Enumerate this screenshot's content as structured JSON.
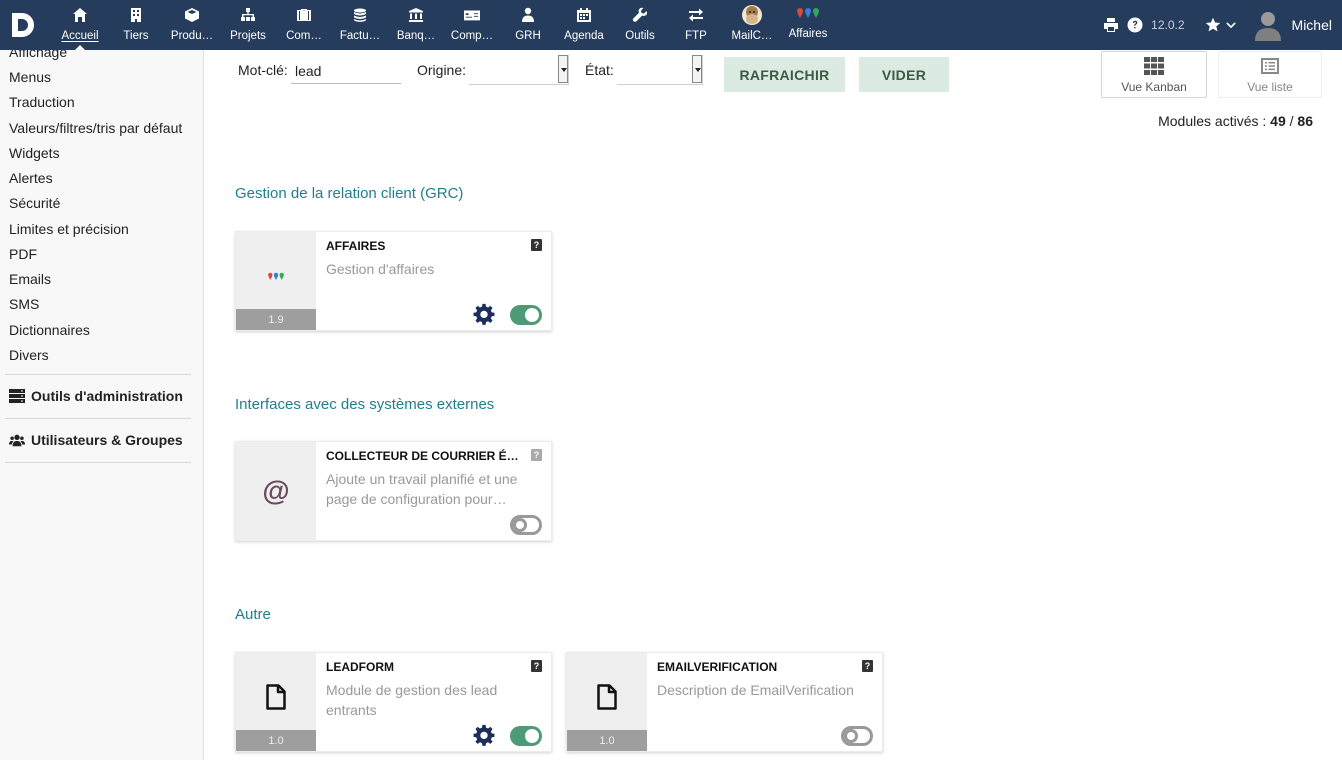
{
  "topbar": {
    "version": "12.0.2",
    "username": "Michel",
    "nav": [
      {
        "label": "Accueil",
        "icon": "home-icon",
        "active": true
      },
      {
        "label": "Tiers",
        "icon": "building-icon"
      },
      {
        "label": "Produ…",
        "icon": "cube-icon"
      },
      {
        "label": "Projets",
        "icon": "sitemap-icon"
      },
      {
        "label": "Com…",
        "icon": "suitcase-icon"
      },
      {
        "label": "Factu…",
        "icon": "coins-icon"
      },
      {
        "label": "Banq…",
        "icon": "bank-icon"
      },
      {
        "label": "Comp…",
        "icon": "money-check-icon"
      },
      {
        "label": "GRH",
        "icon": "user-tie-icon"
      },
      {
        "label": "Agenda",
        "icon": "calendar-icon"
      },
      {
        "label": "Outils",
        "icon": "wrench-icon"
      },
      {
        "label": "FTP",
        "icon": "exchange-icon"
      },
      {
        "label": "MailC…",
        "icon": "mailchimp-icon"
      },
      {
        "label": "Affaires",
        "icon": "pins-icon"
      }
    ]
  },
  "sidebar": {
    "items": [
      "Affichage",
      "Menus",
      "Traduction",
      "Valeurs/filtres/tris par défaut",
      "Widgets",
      "Alertes",
      "Sécurité",
      "Limites et précision",
      "PDF",
      "Emails",
      "SMS",
      "Dictionnaires",
      "Divers"
    ],
    "admin_tools": "Outils d'administration",
    "users_groups": "Utilisateurs & Groupes"
  },
  "filters": {
    "keyword_label": "Mot-clé:",
    "keyword_value": "lead",
    "origin_label": "Origine:",
    "state_label": "État:",
    "refresh_label": "RAFRAICHIR",
    "clear_label": "VIDER",
    "kanban_label": "Vue Kanban",
    "list_label": "Vue liste"
  },
  "counts": {
    "label": "Modules activés :",
    "active": "49",
    "sep": "/",
    "total": "86"
  },
  "sections": [
    {
      "title": "Gestion de la relation client (GRC)"
    },
    {
      "title": "Interfaces avec des systèmes externes"
    },
    {
      "title": "Autre"
    }
  ],
  "modules": [
    {
      "title": "AFFAIRES",
      "desc": "Gestion d'affaires",
      "version": "1.9",
      "enabled": true,
      "icon": "pins-icon"
    },
    {
      "title": "COLLECTEUR DE COURRIER É…",
      "desc": "Ajoute un travail planifié et une page de configuration pour…",
      "version": "",
      "enabled": false,
      "icon": "at-icon"
    },
    {
      "title": "LEADFORM",
      "desc": "Module de gestion des lead entrants",
      "version": "1.0",
      "enabled": true,
      "icon": "file-icon"
    },
    {
      "title": "EMAILVERIFICATION",
      "desc": "Description de EmailVerification",
      "version": "1.0",
      "enabled": false,
      "icon": "file-icon"
    }
  ],
  "colors": {
    "topbar": "#263c5c",
    "section_title": "#1e7f8e",
    "toggle_on": "#4f9a76",
    "button_bg": "#dcebe1"
  }
}
